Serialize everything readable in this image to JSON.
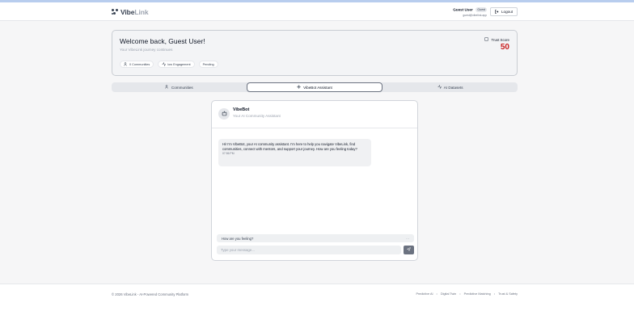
{
  "brand": {
    "name_main": "Vibe",
    "name_accent": "Link"
  },
  "user": {
    "name": "Guest User",
    "badge": "Guest",
    "email": "guest@vibelink.app"
  },
  "header": {
    "logout_label": "Logout"
  },
  "welcome": {
    "title": "Welcome back, Guest User!",
    "subtitle": "Your VibeLink journey continues",
    "chips": [
      {
        "icon": "people-icon",
        "label": "0 Communities"
      },
      {
        "icon": "activity-icon",
        "label": "low Engagement"
      },
      {
        "icon": "",
        "label": "Pending"
      }
    ],
    "trust_label": "Trust Score",
    "trust_value": "50"
  },
  "tabs": [
    {
      "icon": "people-icon",
      "label": "Communities",
      "active": false
    },
    {
      "icon": "sparkle-icon",
      "label": "VibeBot Assistant",
      "active": true
    },
    {
      "icon": "activity-icon",
      "label": "AI Datasets",
      "active": false
    }
  ],
  "chat": {
    "bot_name": "VibeBot",
    "bot_role": "Your AI Community Assistant",
    "message": {
      "text": "Hi! I'm VibeBot, your AI community assistant. I'm here to help you navigate VibeLink, find communities, connect with mentors, and support your journey. How are you feeling today?",
      "time": "07:56 PM"
    },
    "suggestion": "How are you feeling?",
    "input_placeholder": "Type your message..."
  },
  "footer": {
    "copyright": "© 2026 VibeLink - AI-Powered Community Platform",
    "links": [
      "Predictive AI",
      "Digital Twin",
      "Predictive Matching",
      "Trust & Safety"
    ]
  },
  "colors": {
    "trust_value": "#c81e1e",
    "accent_bar": "#b8cdee"
  }
}
